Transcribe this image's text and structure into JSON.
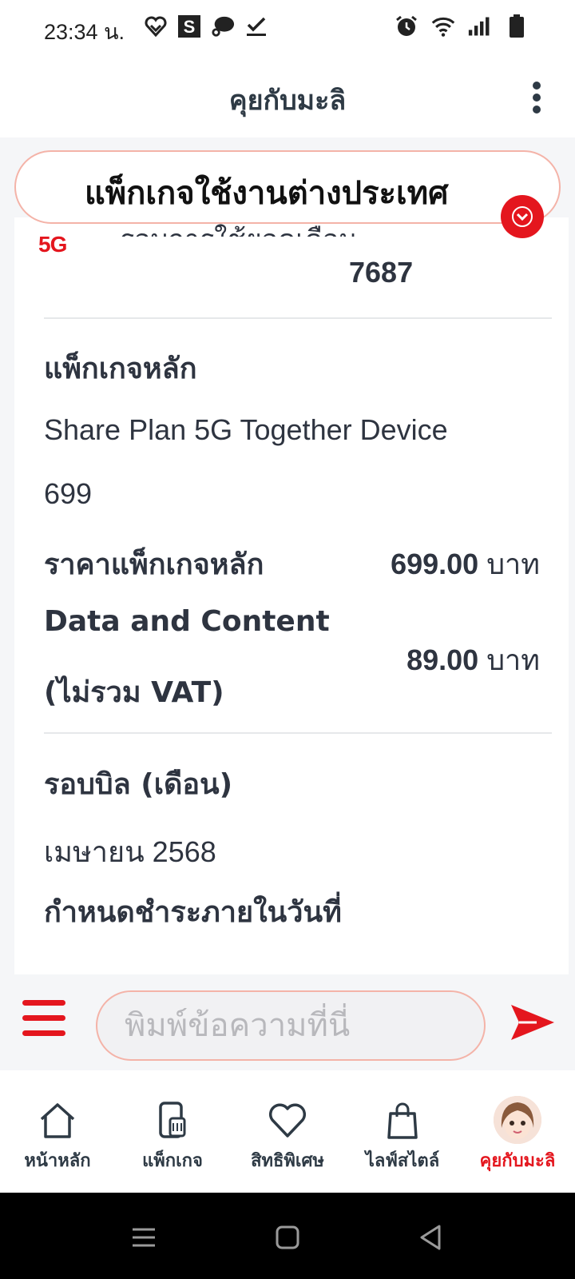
{
  "status_bar": {
    "time": "23:34 น.",
    "left_icons": [
      "heart-hands-icon",
      "s-app-icon",
      "chat-bubble-icon",
      "check-icon"
    ],
    "right_icons": [
      "alarm-icon",
      "wifi-icon",
      "signal-icon",
      "battery-icon"
    ]
  },
  "header": {
    "title": "คุยกับมะลิ",
    "more_icon": "more-vertical-icon"
  },
  "pinned": {
    "title": "แพ็กเกจใช้งานต่างประเทศ",
    "pin_icon": "pin-icon",
    "badge_text": "5G",
    "expand_icon": "chevron-down-icon"
  },
  "message": {
    "partial_text": "รอบการใช้ยอดเดือน",
    "number_value": "7687",
    "main_package_label": "แพ็กเกจหลัก",
    "main_package_name_line1": "Share Plan 5G Together Device",
    "main_package_name_line2": "699",
    "main_price_label": "ราคาแพ็กเกจหลัก",
    "main_price_value": "699.00",
    "main_price_unit": "บาท",
    "data_content_label_line1": "Data and Content",
    "data_content_label_line2": "(ไม่รวม VAT)",
    "data_content_value": "89.00",
    "data_content_unit": "บาท",
    "bill_cycle_label": "รอบบิล (เดือน)",
    "bill_cycle_value": "เมษายน 2568",
    "due_date_label": "กำหนดชำระภายในวันที่"
  },
  "input": {
    "placeholder": "พิมพ์ข้อความที่นี่"
  },
  "bottom_nav": [
    {
      "label": "หน้าหลัก",
      "icon": "home-icon"
    },
    {
      "label": "แพ็กเกจ",
      "icon": "sim-package-icon"
    },
    {
      "label": "สิทธิพิเศษ",
      "icon": "heart-icon"
    },
    {
      "label": "ไลฟ์สไตล์",
      "icon": "shopping-bag-icon"
    },
    {
      "label": "คุยกับมะลิ",
      "icon": "mali-avatar-icon",
      "active": true
    }
  ],
  "colors": {
    "accent": "#e4161e",
    "text": "#2e3440",
    "pinned_border": "#f4b3a8"
  }
}
